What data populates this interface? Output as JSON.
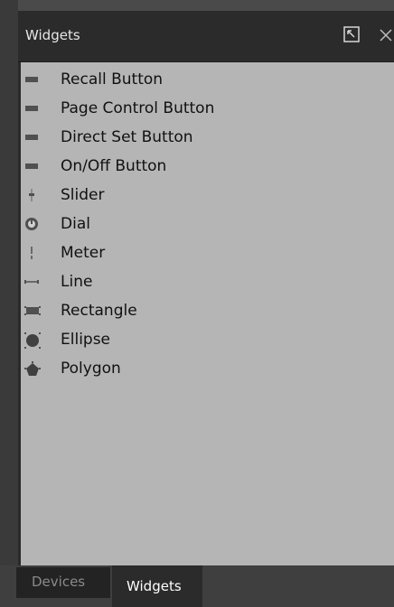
{
  "panel": {
    "title": "Widgets",
    "undock_icon": "undock-icon",
    "close_icon": "close-icon"
  },
  "widgets": [
    {
      "label": "Recall Button",
      "icon": "button-icon"
    },
    {
      "label": "Page Control Button",
      "icon": "button-icon"
    },
    {
      "label": "Direct Set Button",
      "icon": "button-icon"
    },
    {
      "label": "On/Off Button",
      "icon": "button-icon"
    },
    {
      "label": "Slider",
      "icon": "slider-icon"
    },
    {
      "label": "Dial",
      "icon": "dial-icon"
    },
    {
      "label": "Meter",
      "icon": "meter-icon"
    },
    {
      "label": "Line",
      "icon": "line-icon"
    },
    {
      "label": "Rectangle",
      "icon": "rectangle-icon"
    },
    {
      "label": "Ellipse",
      "icon": "ellipse-icon"
    },
    {
      "label": "Polygon",
      "icon": "polygon-icon"
    }
  ],
  "tabs": {
    "devices": "Devices",
    "widgets": "Widgets",
    "active": "Widgets"
  },
  "colors": {
    "list_background": "#b5b5b5",
    "header_background": "#2b2b2b",
    "icon_color": "#505050"
  }
}
